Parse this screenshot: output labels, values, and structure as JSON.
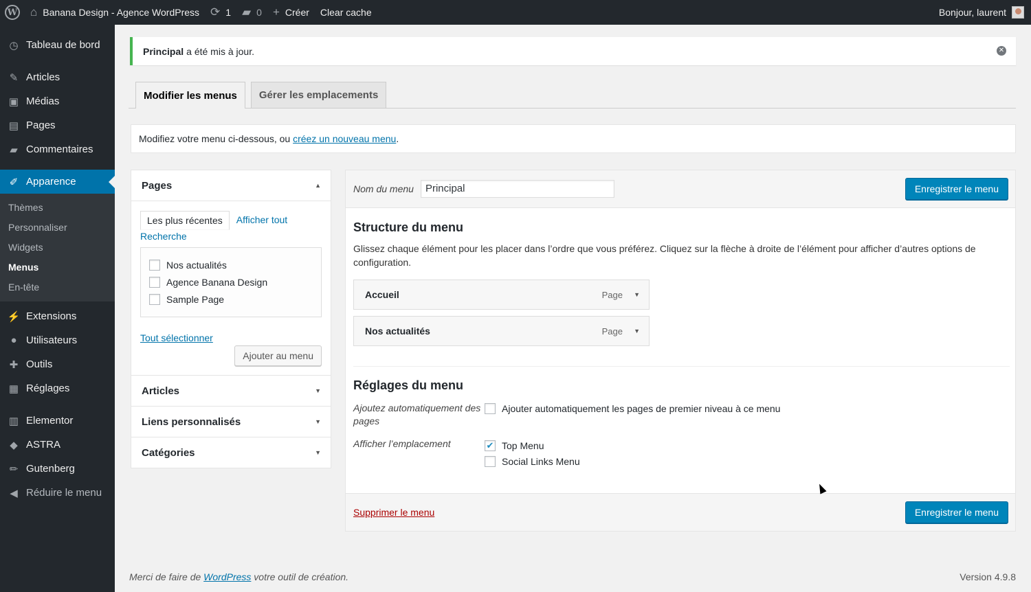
{
  "adminbar": {
    "site_name": "Banana Design - Agence WordPress",
    "updates_count": "1",
    "comments_count": "0",
    "new_label": "Créer",
    "clear_cache": "Clear cache",
    "greeting": "Bonjour, laurent"
  },
  "sidebar": {
    "items": [
      {
        "label": "Tableau de bord",
        "icon": "dashboard-icon"
      },
      {
        "label": "Articles",
        "icon": "pin-icon"
      },
      {
        "label": "Médias",
        "icon": "media-icon"
      },
      {
        "label": "Pages",
        "icon": "page-icon"
      },
      {
        "label": "Commentaires",
        "icon": "comment-icon"
      },
      {
        "label": "Apparence",
        "icon": "brush-icon"
      },
      {
        "label": "Extensions",
        "icon": "plugin-icon"
      },
      {
        "label": "Utilisateurs",
        "icon": "users-icon"
      },
      {
        "label": "Outils",
        "icon": "tools-icon"
      },
      {
        "label": "Réglages",
        "icon": "settings-icon"
      },
      {
        "label": "Elementor",
        "icon": "elementor-icon"
      },
      {
        "label": "ASTRA",
        "icon": "astra-icon"
      },
      {
        "label": "Gutenberg",
        "icon": "pencil-icon"
      },
      {
        "label": "Réduire le menu",
        "icon": "collapse-icon"
      }
    ],
    "submenu": [
      "Thèmes",
      "Personnaliser",
      "Widgets",
      "Menus",
      "En-tête"
    ]
  },
  "notice": {
    "bold": "Principal",
    "text": "a été mis à jour."
  },
  "tabs": [
    "Modifier les menus",
    "Gérer les emplacements"
  ],
  "manage": {
    "text": "Modifiez votre menu ci-dessous, ou",
    "link": "créez un nouveau menu",
    "end": "."
  },
  "pages_box": {
    "title": "Pages",
    "subtabs": [
      "Les plus récentes",
      "Afficher tout",
      "Recherche"
    ],
    "items": [
      "Nos actualités",
      "Agence Banana Design",
      "Sample Page"
    ],
    "select_all": "Tout sélectionner",
    "add_button": "Ajouter au menu"
  },
  "accordion_sections": [
    "Articles",
    "Liens personnalisés",
    "Catégories"
  ],
  "menu_edit": {
    "name_label": "Nom du menu",
    "name_value": "Principal",
    "save_label": "Enregistrer le menu",
    "structure_title": "Structure du menu",
    "structure_desc": "Glissez chaque élément pour les placer dans l’ordre que vous préférez. Cliquez sur la flèche à droite de l’élément pour afficher d’autres options de configuration.",
    "items": [
      {
        "title": "Accueil",
        "type": "Page"
      },
      {
        "title": "Nos actualités",
        "type": "Page"
      }
    ],
    "settings_title": "Réglages du menu",
    "auto_add_label": "Ajoutez automatiquement des pages",
    "auto_add_option": "Ajouter automatiquement les pages de premier niveau à ce menu",
    "location_label": "Afficher l’emplacement",
    "locations": [
      {
        "label": "Top Menu",
        "checked": true
      },
      {
        "label": "Social Links Menu",
        "checked": false
      }
    ],
    "delete_label": "Supprimer le menu"
  },
  "footer": {
    "thanks_prefix": "Merci de faire de",
    "thanks_link": "WordPress",
    "thanks_suffix": "votre outil de création.",
    "version": "Version 4.9.8"
  },
  "colors": {
    "accent": "#0073aa",
    "primary_button": "#0085ba",
    "notice_success": "#46b450",
    "delete": "#a00000"
  }
}
